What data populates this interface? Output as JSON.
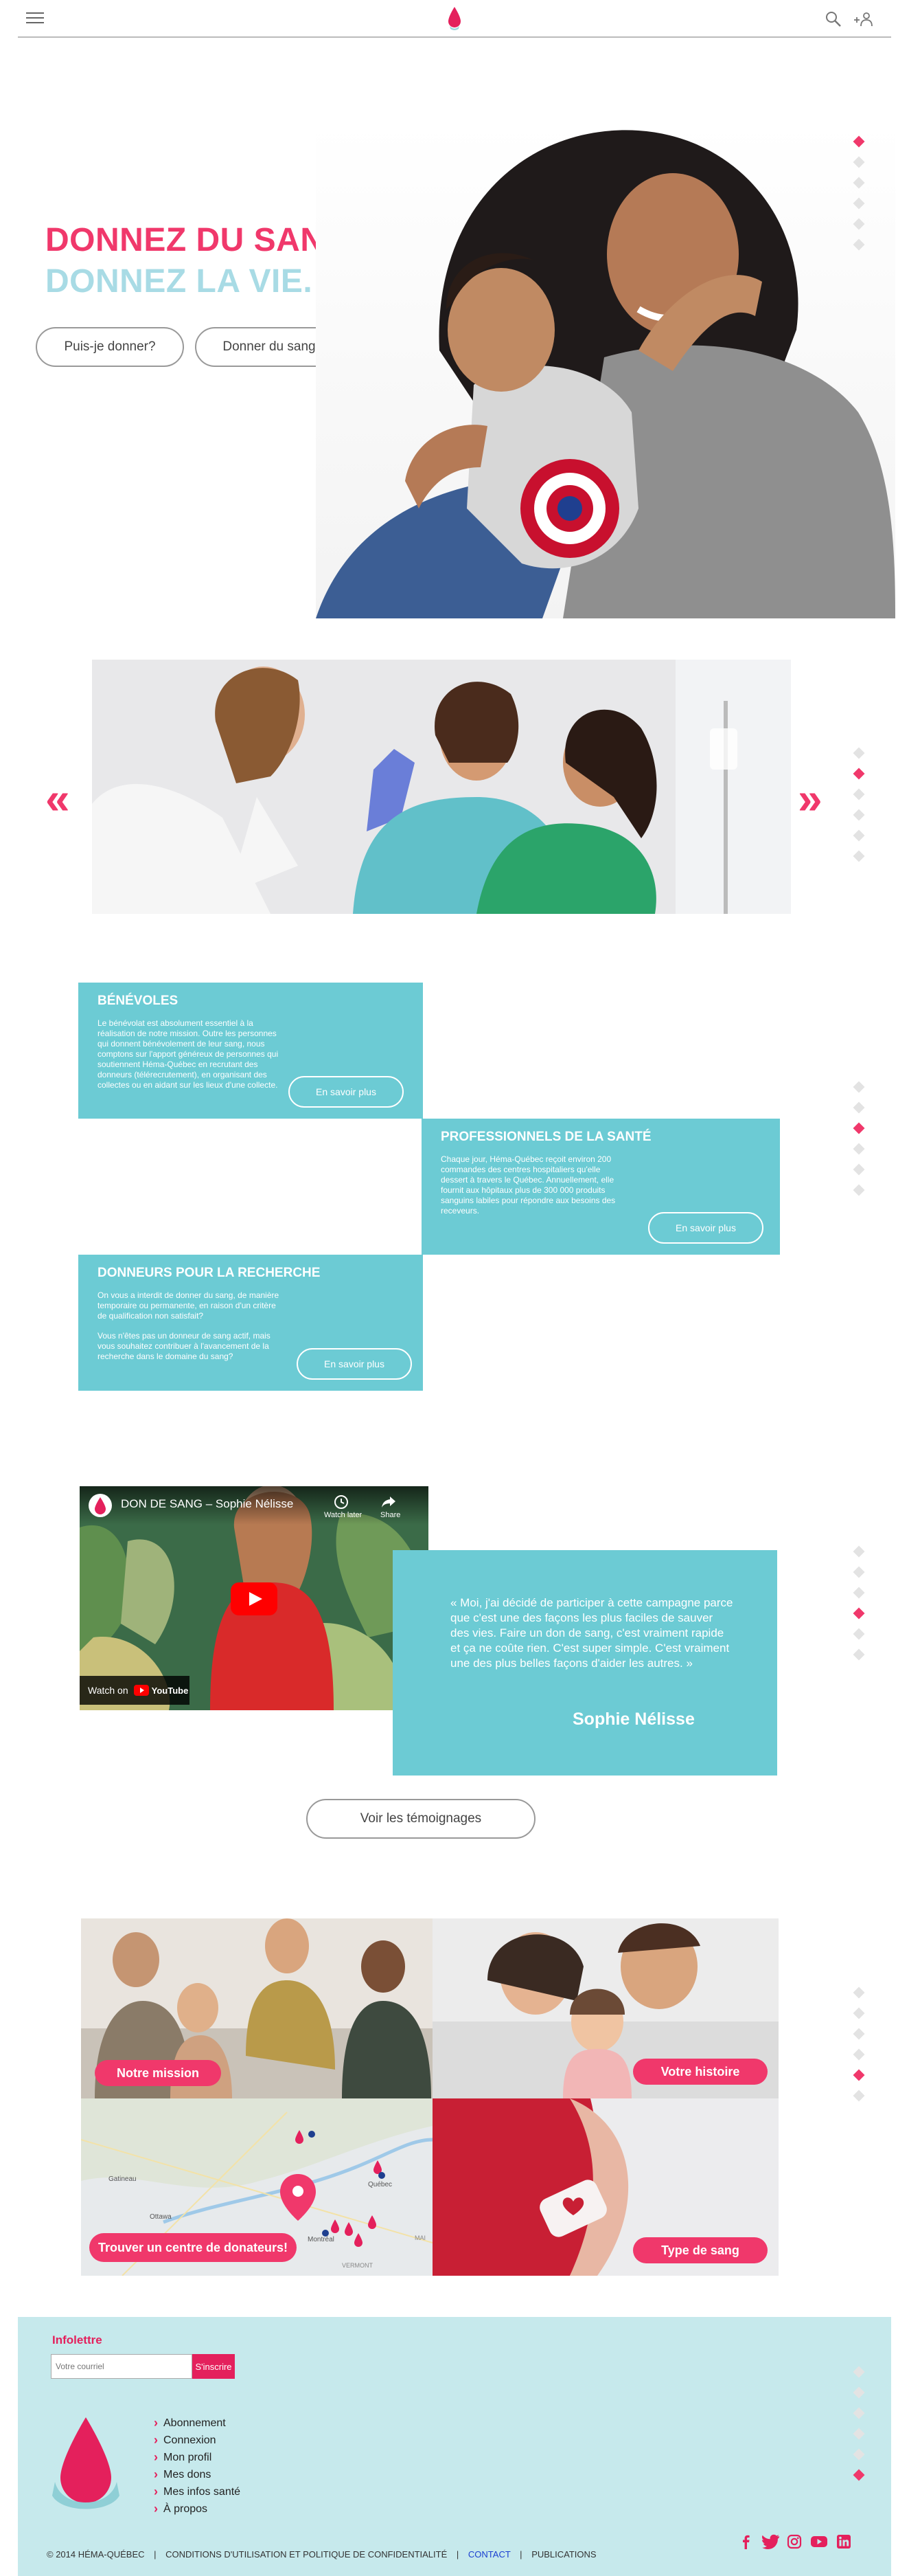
{
  "colors": {
    "accent": "#f0386b",
    "teal": "#6ccbd4",
    "light_teal": "#a8dbe5",
    "footer_bg": "#c6e9ec"
  },
  "header": {
    "menu_icon": "hamburger-menu-icon",
    "logo": "blood-drop-logo",
    "search_icon": "search-icon",
    "account_icon": "account-icon"
  },
  "hero": {
    "title_line1": "DONNEZ DU SANG,",
    "title_line2": "DONNEZ LA VIE.",
    "btn_can_i_give": "Puis-je donner?",
    "btn_give_blood": "Donner du sang"
  },
  "cards": {
    "benevoles": {
      "title": "BÉNÉVOLES",
      "text": "Le bénévolat est absolument essentiel à la réalisation de notre mission. Outre les personnes qui donnent bénévolement de leur sang, nous comptons sur l'apport généreux de personnes qui soutiennent Héma-Québec en recrutant des donneurs (télérecrutement), en organisant des collectes ou en aidant sur les lieux d'une collecte.",
      "button": "En savoir plus"
    },
    "professionnels": {
      "title": "PROFESSIONNELS DE LA SANTÉ",
      "text": "Chaque jour, Héma-Québec reçoit environ 200 commandes des centres hospitaliers qu'elle dessert à travers le Québec. Annuellement, elle fournit aux hôpitaux plus de 300 000 produits sanguins labiles pour répondre aux besoins des receveurs.",
      "button": "En savoir plus"
    },
    "recherche": {
      "title": "DONNEURS POUR LA RECHERCHE",
      "text1": "On vous a interdit de donner du sang, de manière temporaire ou permanente, en raison d'un critère de qualification non satisfait?",
      "text2": "Vous n'êtes pas un donneur de sang actif, mais vous souhaitez contribuer à l'avancement de la recherche dans le domaine du sang?",
      "button": "En savoir plus"
    }
  },
  "video": {
    "title": "DON DE SANG – Sophie Nélisse",
    "watch_later": "Watch later",
    "share": "Share",
    "watch_on": "Watch on",
    "youtube": "YouTube"
  },
  "testimonial": {
    "quote": "« Moi, j'ai décidé de participer à  cette campagne parce que  c'est une des façons les plus faciles de sauver des vies. Faire un don de sang, c'est vraiment rapide et ça ne coûte rien. C'est super simple. C'est vraiment une des plus belles façons d'aider les autres. »",
    "author": "Sophie Nélisse",
    "button": "Voir les témoignages"
  },
  "tiles": {
    "mission": "Notre mission",
    "histoire": "Votre histoire",
    "centre": "Trouver un centre de donateurs!",
    "type": "Type de sang"
  },
  "map_labels": [
    "Ottawa",
    "Montréal",
    "Québec",
    "Gatineau",
    "VERMONT",
    "MAI"
  ],
  "footer": {
    "newsletter_title": "Infolettre",
    "email_placeholder": "Votre courriel",
    "subscribe": "S'inscrire",
    "links": [
      "Abonnement",
      "Connexion",
      "Mon profil",
      "Mes dons",
      "Mes infos santé",
      "À propos"
    ],
    "copyright": "© 2014 HÉMA-QUÉBEC",
    "terms": "CONDITIONS D'UTILISATION ET POLITIQUE DE CONFIDENTIALITÉ",
    "contact": "CONTACT",
    "publications": "PUBLICATIONS",
    "separator": "|"
  },
  "social": [
    "facebook-icon",
    "twitter-icon",
    "instagram-icon",
    "youtube-icon",
    "linkedin-icon"
  ]
}
